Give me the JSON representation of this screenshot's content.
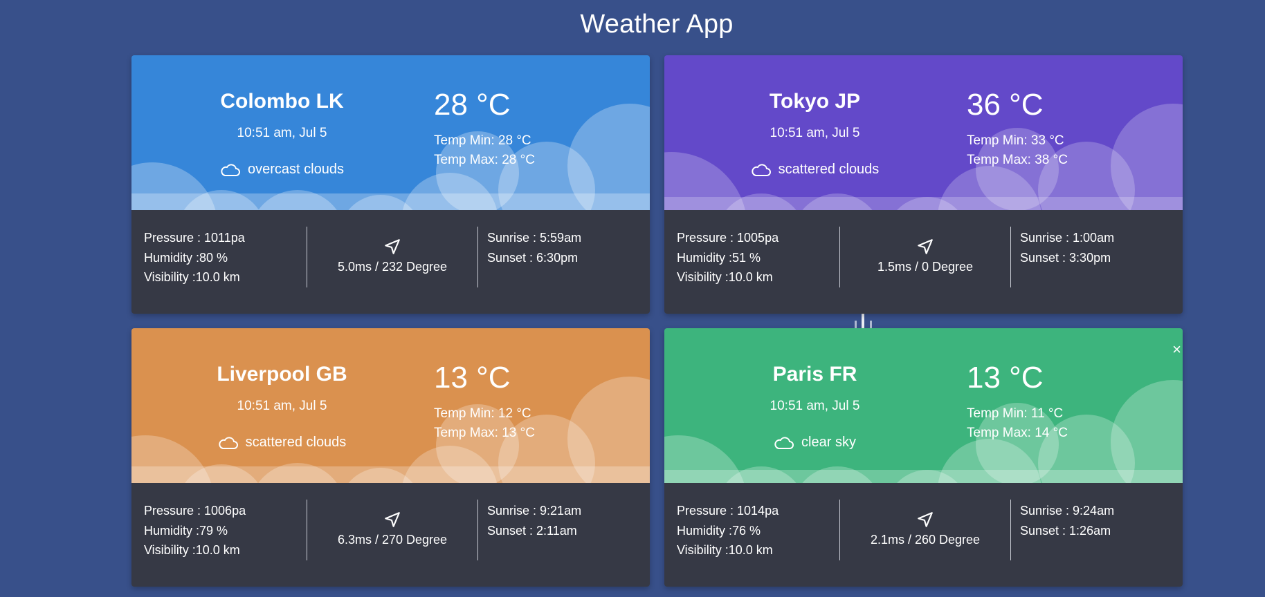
{
  "app": {
    "title": "Weather App"
  },
  "cards": [
    {
      "city": "Colombo LK",
      "time": "10:51 am, Jul 5",
      "description": "overcast clouds",
      "temp": "28 °C",
      "temp_min": "Temp Min: 28 °C",
      "temp_max": "Temp Max: 28 °C",
      "pressure": "Pressure : 1011pa",
      "humidity": "Humidity :80 %",
      "visibility": "Visibility :10.0 km",
      "wind": "5.0ms / 232 Degree",
      "sunrise": "Sunrise : 5:59am",
      "sunset": "Sunset : 6:30pm",
      "color": "#3686d9"
    },
    {
      "city": "Tokyo JP",
      "time": "10:51 am, Jul 5",
      "description": "scattered clouds",
      "temp": "36 °C",
      "temp_min": "Temp Min: 33 °C",
      "temp_max": "Temp Max: 38 °C",
      "pressure": "Pressure : 1005pa",
      "humidity": "Humidity :51 %",
      "visibility": "Visibility :10.0 km",
      "wind": "1.5ms / 0 Degree",
      "sunrise": "Sunrise : 1:00am",
      "sunset": "Sunset : 3:30pm",
      "color": "#6349c9"
    },
    {
      "city": "Liverpool GB",
      "time": "10:51 am, Jul 5",
      "description": "scattered clouds",
      "temp": "13 °C",
      "temp_min": "Temp Min: 12 °C",
      "temp_max": "Temp Max: 13 °C",
      "pressure": "Pressure : 1006pa",
      "humidity": "Humidity :79 %",
      "visibility": "Visibility :10.0 km",
      "wind": "6.3ms / 270 Degree",
      "sunrise": "Sunrise : 9:21am",
      "sunset": "Sunset : 2:11am",
      "color": "#da914f"
    },
    {
      "city": "Paris FR",
      "time": "10:51 am, Jul 5",
      "description": "clear sky",
      "temp": "13 °C",
      "temp_min": "Temp Min: 11 °C",
      "temp_max": "Temp Max: 14 °C",
      "pressure": "Pressure : 1014pa",
      "humidity": "Humidity :76 %",
      "visibility": "Visibility :10.0 km",
      "wind": "2.1ms / 260 Degree",
      "sunrise": "Sunrise : 9:24am",
      "sunset": "Sunset : 1:26am",
      "color": "#3db47d",
      "close_label": "×"
    }
  ],
  "colors": {
    "background": "#38508a",
    "card_bottom": "#363945"
  },
  "icons": {
    "description": "cloud-icon",
    "wind": "navigation-arrow-icon",
    "close": "close-icon"
  }
}
